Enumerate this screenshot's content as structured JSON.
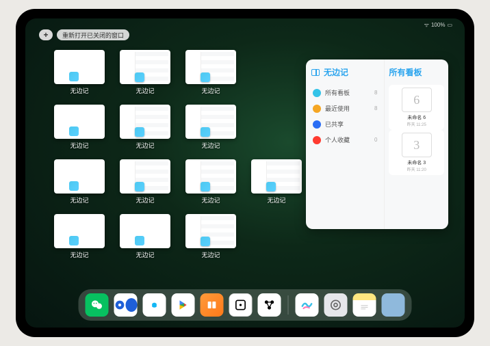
{
  "status": {
    "signal": "100%"
  },
  "topbar": {
    "add_label": "+",
    "reopen_label": "重新打开已关闭的窗口"
  },
  "tile_label": "无边记",
  "tiles": [
    {
      "variant": "blank"
    },
    {
      "variant": "grid"
    },
    {
      "variant": "grid"
    },
    null,
    {
      "variant": "blank"
    },
    {
      "variant": "grid"
    },
    {
      "variant": "grid"
    },
    null,
    {
      "variant": "blank"
    },
    {
      "variant": "grid"
    },
    {
      "variant": "grid"
    },
    {
      "variant": "grid"
    },
    {
      "variant": "blank"
    },
    {
      "variant": "blank"
    },
    {
      "variant": "grid"
    }
  ],
  "panel": {
    "left_title": "无边记",
    "nav": [
      {
        "label": "所有看板",
        "count": "8",
        "color": "#34c3e8"
      },
      {
        "label": "最近使用",
        "count": "8",
        "color": "#f5a623"
      },
      {
        "label": "已共享",
        "count": "",
        "color": "#2a6df4"
      },
      {
        "label": "个人收藏",
        "count": "0",
        "color": "#ff3b30"
      }
    ],
    "right_title": "所有看板",
    "boards": [
      {
        "glyph": "6",
        "name": "未命名 6",
        "time": "昨天 11:25"
      },
      {
        "glyph": "3",
        "name": "未命名 3",
        "time": "昨天 11:20"
      }
    ]
  },
  "dock": {
    "apps": [
      "wechat",
      "blue-circle",
      "qq",
      "play",
      "books",
      "dice",
      "connect"
    ],
    "recent": [
      "freeform",
      "settings",
      "notes",
      "folder"
    ]
  }
}
